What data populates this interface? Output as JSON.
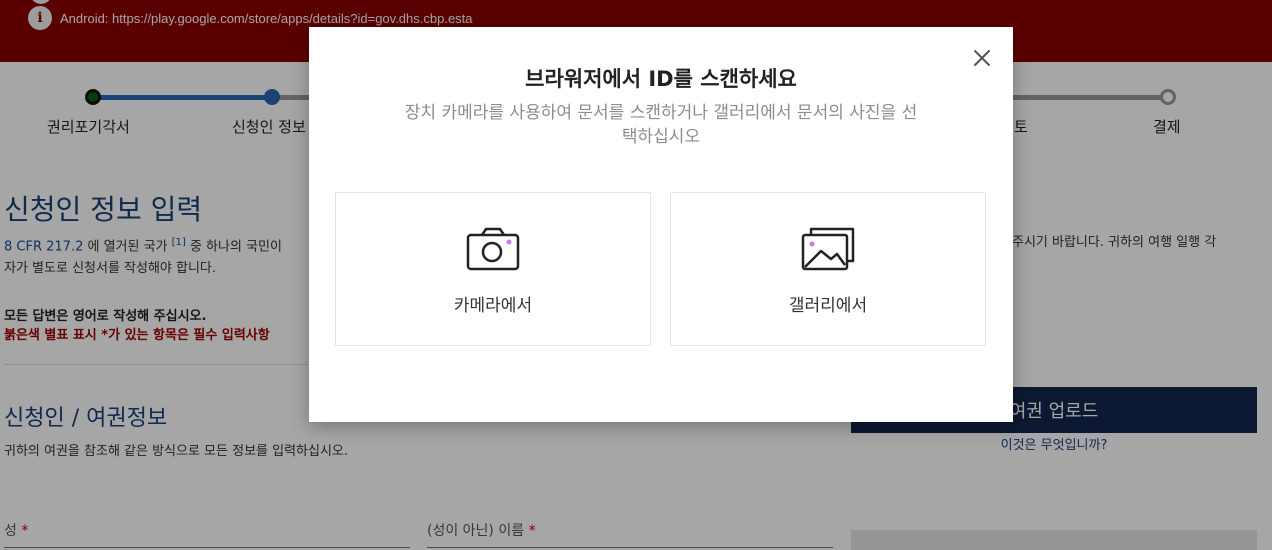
{
  "banner": {
    "android_text": "Android: https://play.google.com/store/apps/details?id=gov.dhs.cbp.esta"
  },
  "progress": {
    "steps": [
      {
        "label": "권리포기각서"
      },
      {
        "label": "신청인 정보"
      },
      {
        "label": "토"
      },
      {
        "label": "결제"
      }
    ]
  },
  "page": {
    "title": "신청인 정보 입력",
    "intro_link": "8 CFR 217.2",
    "intro_mid": " 에 열거된 국가 ",
    "intro_sup": "[1]",
    "intro_end": " 중 하나의 국민이",
    "intro_line2": "자가 별도로 신청서를 작성해야 합니다.",
    "intro_right": "주시기 바랍니다. 귀하의 여행 일행 각",
    "note_bold": "모든 답변은 영어로 작성해 주십시오.",
    "note_red": "붉은색 별표 표시 *가 있는 항목은 필수 입력사항",
    "section_title": "신청인 / 여권정보",
    "section_desc": "귀하의 여권을 참조해 같은 방식으로 모든 정보를 입력하십시오.",
    "field_surname": "성",
    "field_given": "(성이 아닌) 이름",
    "required_mark": "*",
    "upload_button": "여권 업로드",
    "what_link": "이것은 무엇입니까?"
  },
  "modal": {
    "title": "브라워저에서 ID를 스캔하세요",
    "subtitle": "장치 카메라를 사용하여 문서를 스캔하거나 갤러리에서 문서의 사진을 선택하십시오",
    "options": [
      {
        "label": "카메라에서",
        "icon": "camera-icon"
      },
      {
        "label": "갤러리에서",
        "icon": "gallery-icon"
      }
    ],
    "accent_color": "#c47de8"
  }
}
